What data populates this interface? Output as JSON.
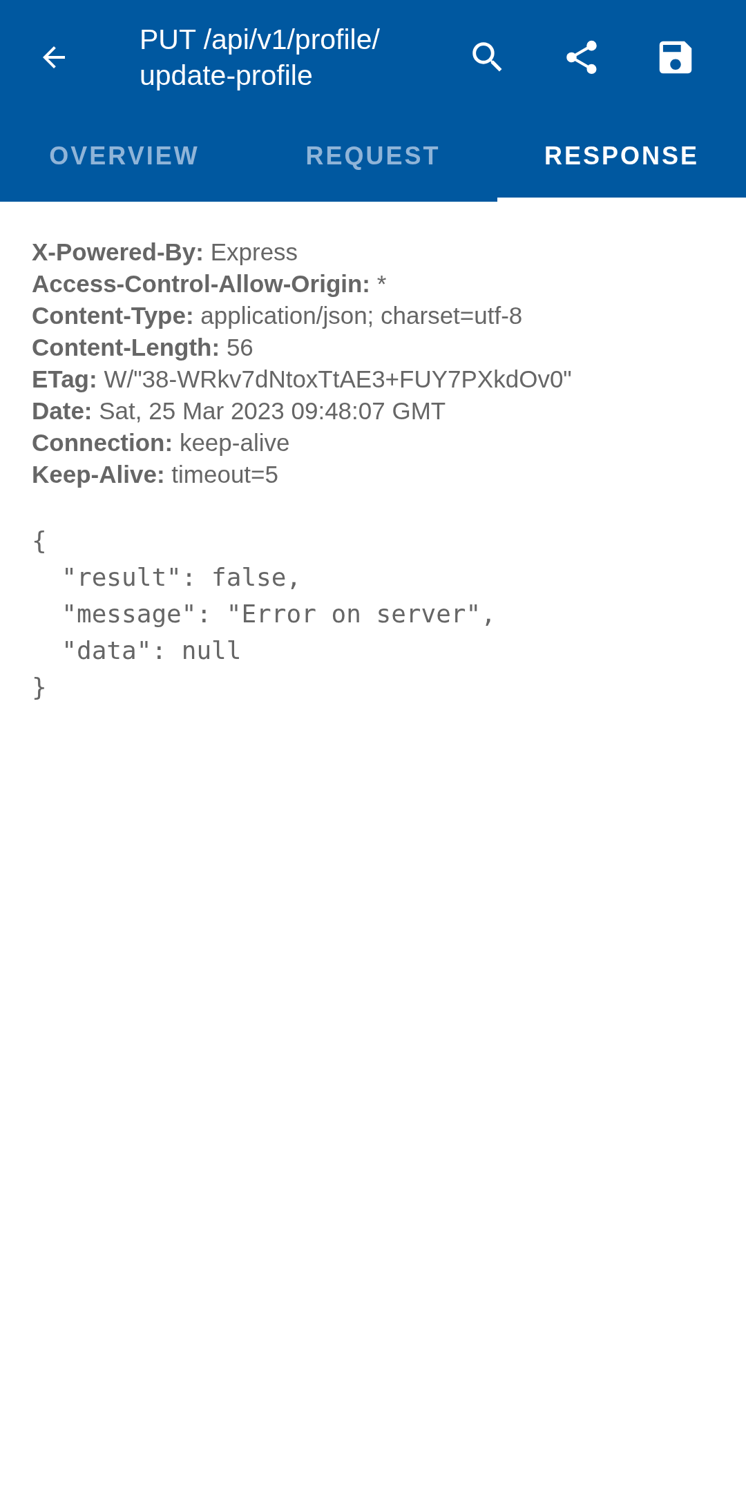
{
  "app_bar": {
    "title": "PUT /api/v1/profile/ update-profile"
  },
  "tabs": [
    {
      "label": "OVERVIEW",
      "selected": false
    },
    {
      "label": "REQUEST",
      "selected": false
    },
    {
      "label": "RESPONSE",
      "selected": true
    }
  ],
  "headers": [
    {
      "name": "X-Powered-By:",
      "value": "Express"
    },
    {
      "name": "Access-Control-Allow-Origin:",
      "value": "*"
    },
    {
      "name": "Content-Type:",
      "value": "application/json; charset=utf-8"
    },
    {
      "name": "Content-Length:",
      "value": "56"
    },
    {
      "name": "ETag:",
      "value": "W/\"38-WRkv7dNtoxTtAE3+FUY7PXkdOv0\""
    },
    {
      "name": "Date:",
      "value": "Sat, 25 Mar 2023 09:48:07 GMT"
    },
    {
      "name": "Connection:",
      "value": "keep-alive"
    },
    {
      "name": "Keep-Alive:",
      "value": "timeout=5"
    }
  ],
  "body": [
    "{",
    "  \"result\": false,",
    "  \"message\": \"Error on server\",",
    "  \"data\": null",
    "}"
  ]
}
